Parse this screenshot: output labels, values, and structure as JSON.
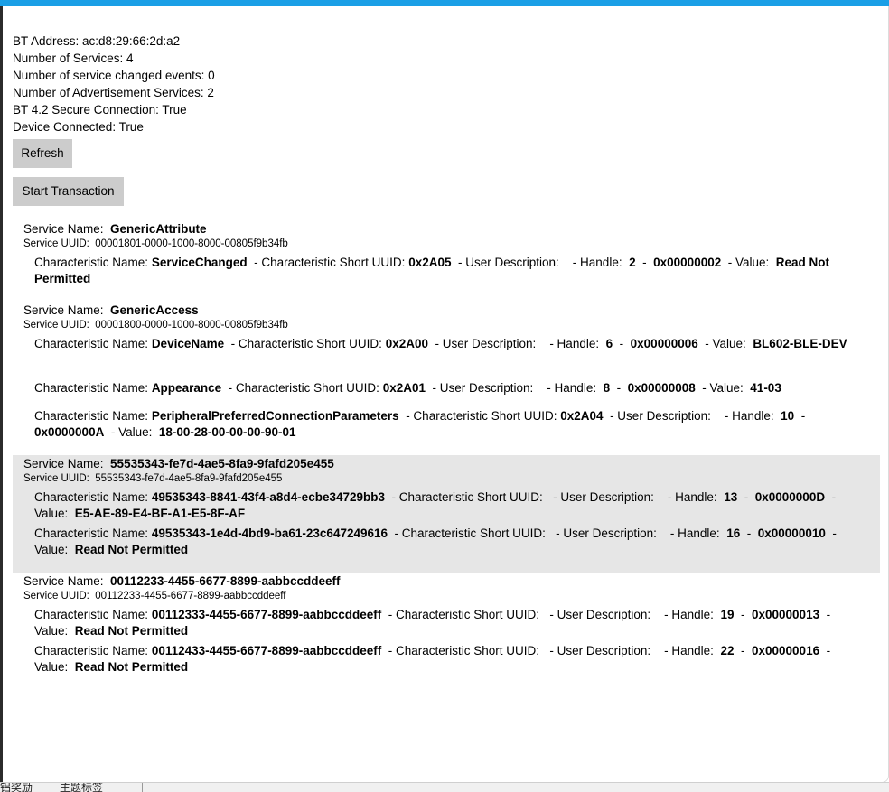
{
  "device": {
    "bt_address": "BT Address:  ac:d8:29:66:2d:a2",
    "num_services": "Number of Services: 4",
    "num_changed": "Number of service changed events: 0",
    "num_adv": "Number of Advertisement Services: 2",
    "secure": "BT 4.2 Secure Connection: True",
    "connected": "Device Connected: True"
  },
  "buttons": {
    "refresh": "Refresh",
    "start": "Start Transaction"
  },
  "labels": {
    "service_name": "Service Name:",
    "service_uuid": "Service UUID:",
    "char_name": "Characteristic Name:",
    "short_uuid": "- Characteristic Short UUID:",
    "user_desc": "- User Description:",
    "handle": "- Handle:",
    "value": "- Value:",
    "dash": "-"
  },
  "services": [
    {
      "name": "GenericAttribute",
      "uuid": "00001801-0000-1000-8000-00805f9b34fb",
      "chars": [
        {
          "name": "ServiceChanged",
          "short_uuid": "0x2A05",
          "desc": "",
          "handle": "2",
          "handle_hex": "0x00000002",
          "value": "Read Not Permitted"
        }
      ]
    },
    {
      "name": "GenericAccess",
      "uuid": "00001800-0000-1000-8000-00805f9b34fb",
      "chars": [
        {
          "name": "DeviceName",
          "short_uuid": "0x2A00",
          "desc": "",
          "handle": "6",
          "handle_hex": "0x00000006",
          "value": "BL602-BLE-DEV"
        },
        {
          "name": "Appearance",
          "short_uuid": "0x2A01",
          "desc": "",
          "handle": "8",
          "handle_hex": "0x00000008",
          "value": "41-03"
        },
        {
          "name": "PeripheralPreferredConnectionParameters",
          "short_uuid": "0x2A04",
          "desc": "",
          "handle": "10",
          "handle_hex": "0x0000000A",
          "value": "18-00-28-00-00-00-90-01"
        }
      ]
    },
    {
      "name": "55535343-fe7d-4ae5-8fa9-9fafd205e455",
      "uuid": "55535343-fe7d-4ae5-8fa9-9fafd205e455",
      "chars": [
        {
          "name": "49535343-8841-43f4-a8d4-ecbe34729bb3",
          "short_uuid": "",
          "desc": "",
          "handle": "13",
          "handle_hex": "0x0000000D",
          "value": "E5-AE-89-E4-BF-A1-E5-8F-AF"
        },
        {
          "name": "49535343-1e4d-4bd9-ba61-23c647249616",
          "short_uuid": "",
          "desc": "",
          "handle": "16",
          "handle_hex": "0x00000010",
          "value": "Read Not Permitted"
        }
      ]
    },
    {
      "name": "00112233-4455-6677-8899-aabbccddeeff",
      "uuid": "00112233-4455-6677-8899-aabbccddeeff",
      "chars": [
        {
          "name": "00112333-4455-6677-8899-aabbccddeeff",
          "short_uuid": "",
          "desc": "",
          "handle": "19",
          "handle_hex": "0x00000013",
          "value": "Read Not Permitted"
        },
        {
          "name": "00112433-4455-6677-8899-aabbccddeeff",
          "short_uuid": "",
          "desc": "",
          "handle": "22",
          "handle_hex": "0x00000016",
          "value": "Read Not Permitted"
        }
      ]
    }
  ],
  "taskbar": {
    "tab1": "铝奖励",
    "tab2": "主题标签"
  },
  "colors": {
    "title_accent": "#1a9fe6",
    "button_bg": "#cccccc",
    "highlight_row": "#e6e6e6"
  }
}
